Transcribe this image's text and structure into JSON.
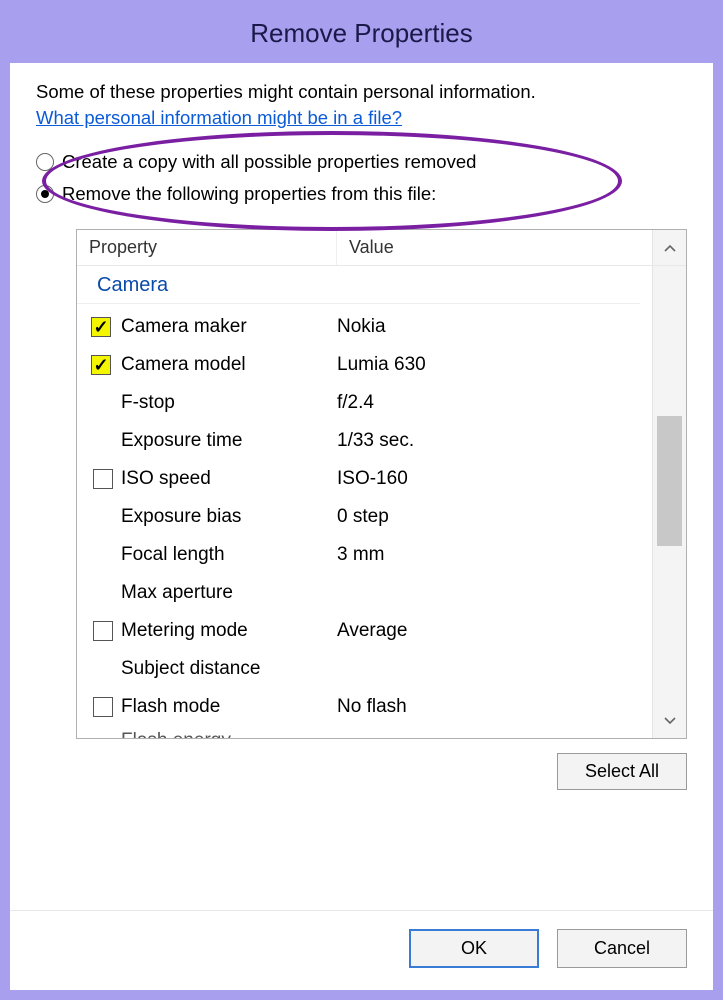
{
  "title": "Remove Properties",
  "intro": "Some of these properties might contain personal information.",
  "help_link": "What personal information might be in a file?",
  "options": {
    "create_copy": "Create a copy with all possible properties removed",
    "remove_selected": "Remove the following properties from this file:"
  },
  "columns": {
    "property": "Property",
    "value": "Value"
  },
  "group": "Camera",
  "rows": [
    {
      "has_cb": true,
      "checked": true,
      "highlight": true,
      "label": "Camera maker",
      "value": "Nokia"
    },
    {
      "has_cb": true,
      "checked": true,
      "highlight": true,
      "label": "Camera model",
      "value": "Lumia 630"
    },
    {
      "has_cb": false,
      "checked": false,
      "highlight": false,
      "label": "F-stop",
      "value": "f/2.4"
    },
    {
      "has_cb": false,
      "checked": false,
      "highlight": false,
      "label": "Exposure time",
      "value": "1/33 sec."
    },
    {
      "has_cb": true,
      "checked": false,
      "highlight": false,
      "label": "ISO speed",
      "value": "ISO-160"
    },
    {
      "has_cb": false,
      "checked": false,
      "highlight": false,
      "label": "Exposure bias",
      "value": "0 step"
    },
    {
      "has_cb": false,
      "checked": false,
      "highlight": false,
      "label": "Focal length",
      "value": "3 mm"
    },
    {
      "has_cb": false,
      "checked": false,
      "highlight": false,
      "label": "Max aperture",
      "value": ""
    },
    {
      "has_cb": true,
      "checked": false,
      "highlight": false,
      "label": "Metering mode",
      "value": "Average"
    },
    {
      "has_cb": false,
      "checked": false,
      "highlight": false,
      "label": "Subject distance",
      "value": ""
    },
    {
      "has_cb": true,
      "checked": false,
      "highlight": false,
      "label": "Flash mode",
      "value": "No flash"
    },
    {
      "has_cb": false,
      "checked": false,
      "highlight": false,
      "label": "Flash energy",
      "value": ""
    }
  ],
  "buttons": {
    "select_all": "Select All",
    "ok": "OK",
    "cancel": "Cancel"
  }
}
